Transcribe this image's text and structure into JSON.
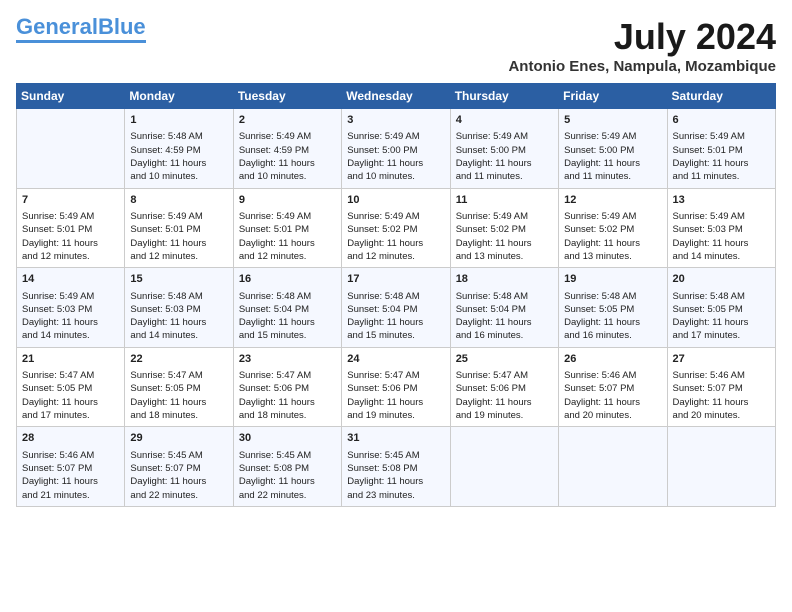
{
  "logo": {
    "part1": "General",
    "part2": "Blue"
  },
  "title": {
    "month_year": "July 2024",
    "location": "Antonio Enes, Nampula, Mozambique"
  },
  "days_of_week": [
    "Sunday",
    "Monday",
    "Tuesday",
    "Wednesday",
    "Thursday",
    "Friday",
    "Saturday"
  ],
  "weeks": [
    [
      {
        "day": "",
        "info": ""
      },
      {
        "day": "1",
        "info": "Sunrise: 5:48 AM\nSunset: 4:59 PM\nDaylight: 11 hours\nand 10 minutes."
      },
      {
        "day": "2",
        "info": "Sunrise: 5:49 AM\nSunset: 4:59 PM\nDaylight: 11 hours\nand 10 minutes."
      },
      {
        "day": "3",
        "info": "Sunrise: 5:49 AM\nSunset: 5:00 PM\nDaylight: 11 hours\nand 10 minutes."
      },
      {
        "day": "4",
        "info": "Sunrise: 5:49 AM\nSunset: 5:00 PM\nDaylight: 11 hours\nand 11 minutes."
      },
      {
        "day": "5",
        "info": "Sunrise: 5:49 AM\nSunset: 5:00 PM\nDaylight: 11 hours\nand 11 minutes."
      },
      {
        "day": "6",
        "info": "Sunrise: 5:49 AM\nSunset: 5:01 PM\nDaylight: 11 hours\nand 11 minutes."
      }
    ],
    [
      {
        "day": "7",
        "info": "Sunrise: 5:49 AM\nSunset: 5:01 PM\nDaylight: 11 hours\nand 12 minutes."
      },
      {
        "day": "8",
        "info": "Sunrise: 5:49 AM\nSunset: 5:01 PM\nDaylight: 11 hours\nand 12 minutes."
      },
      {
        "day": "9",
        "info": "Sunrise: 5:49 AM\nSunset: 5:01 PM\nDaylight: 11 hours\nand 12 minutes."
      },
      {
        "day": "10",
        "info": "Sunrise: 5:49 AM\nSunset: 5:02 PM\nDaylight: 11 hours\nand 12 minutes."
      },
      {
        "day": "11",
        "info": "Sunrise: 5:49 AM\nSunset: 5:02 PM\nDaylight: 11 hours\nand 13 minutes."
      },
      {
        "day": "12",
        "info": "Sunrise: 5:49 AM\nSunset: 5:02 PM\nDaylight: 11 hours\nand 13 minutes."
      },
      {
        "day": "13",
        "info": "Sunrise: 5:49 AM\nSunset: 5:03 PM\nDaylight: 11 hours\nand 14 minutes."
      }
    ],
    [
      {
        "day": "14",
        "info": "Sunrise: 5:49 AM\nSunset: 5:03 PM\nDaylight: 11 hours\nand 14 minutes."
      },
      {
        "day": "15",
        "info": "Sunrise: 5:48 AM\nSunset: 5:03 PM\nDaylight: 11 hours\nand 14 minutes."
      },
      {
        "day": "16",
        "info": "Sunrise: 5:48 AM\nSunset: 5:04 PM\nDaylight: 11 hours\nand 15 minutes."
      },
      {
        "day": "17",
        "info": "Sunrise: 5:48 AM\nSunset: 5:04 PM\nDaylight: 11 hours\nand 15 minutes."
      },
      {
        "day": "18",
        "info": "Sunrise: 5:48 AM\nSunset: 5:04 PM\nDaylight: 11 hours\nand 16 minutes."
      },
      {
        "day": "19",
        "info": "Sunrise: 5:48 AM\nSunset: 5:05 PM\nDaylight: 11 hours\nand 16 minutes."
      },
      {
        "day": "20",
        "info": "Sunrise: 5:48 AM\nSunset: 5:05 PM\nDaylight: 11 hours\nand 17 minutes."
      }
    ],
    [
      {
        "day": "21",
        "info": "Sunrise: 5:47 AM\nSunset: 5:05 PM\nDaylight: 11 hours\nand 17 minutes."
      },
      {
        "day": "22",
        "info": "Sunrise: 5:47 AM\nSunset: 5:05 PM\nDaylight: 11 hours\nand 18 minutes."
      },
      {
        "day": "23",
        "info": "Sunrise: 5:47 AM\nSunset: 5:06 PM\nDaylight: 11 hours\nand 18 minutes."
      },
      {
        "day": "24",
        "info": "Sunrise: 5:47 AM\nSunset: 5:06 PM\nDaylight: 11 hours\nand 19 minutes."
      },
      {
        "day": "25",
        "info": "Sunrise: 5:47 AM\nSunset: 5:06 PM\nDaylight: 11 hours\nand 19 minutes."
      },
      {
        "day": "26",
        "info": "Sunrise: 5:46 AM\nSunset: 5:07 PM\nDaylight: 11 hours\nand 20 minutes."
      },
      {
        "day": "27",
        "info": "Sunrise: 5:46 AM\nSunset: 5:07 PM\nDaylight: 11 hours\nand 20 minutes."
      }
    ],
    [
      {
        "day": "28",
        "info": "Sunrise: 5:46 AM\nSunset: 5:07 PM\nDaylight: 11 hours\nand 21 minutes."
      },
      {
        "day": "29",
        "info": "Sunrise: 5:45 AM\nSunset: 5:07 PM\nDaylight: 11 hours\nand 22 minutes."
      },
      {
        "day": "30",
        "info": "Sunrise: 5:45 AM\nSunset: 5:08 PM\nDaylight: 11 hours\nand 22 minutes."
      },
      {
        "day": "31",
        "info": "Sunrise: 5:45 AM\nSunset: 5:08 PM\nDaylight: 11 hours\nand 23 minutes."
      },
      {
        "day": "",
        "info": ""
      },
      {
        "day": "",
        "info": ""
      },
      {
        "day": "",
        "info": ""
      }
    ]
  ]
}
